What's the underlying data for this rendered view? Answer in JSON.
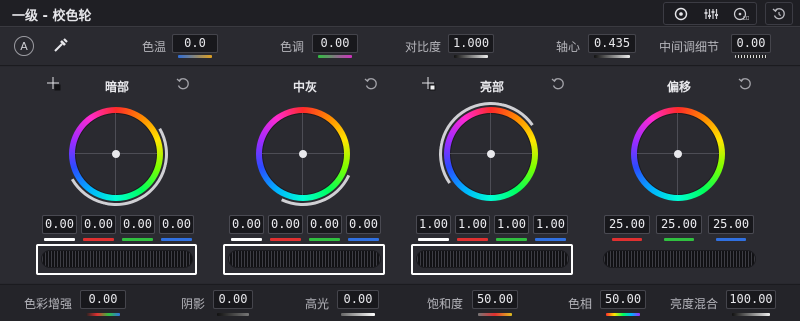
{
  "app": {
    "title": "一级 - 校色轮"
  },
  "toolbar": {
    "icons": [
      "wheels-icon",
      "bars-icon",
      "log-icon",
      "reset-all-icon"
    ],
    "auto_label": "A"
  },
  "params": {
    "temp": {
      "label": "色温",
      "value": "0.0"
    },
    "tint": {
      "label": "色调",
      "value": "0.00"
    },
    "contrast": {
      "label": "对比度",
      "value": "1.000"
    },
    "pivot": {
      "label": "轴心",
      "value": "0.435"
    },
    "middetail": {
      "label": "中间调细节",
      "value": "0.00"
    }
  },
  "wheels": [
    {
      "title": "暗部",
      "values": [
        "0.00",
        "0.00",
        "0.00",
        "0.00"
      ]
    },
    {
      "title": "中灰",
      "values": [
        "0.00",
        "0.00",
        "0.00",
        "0.00"
      ]
    },
    {
      "title": "亮部",
      "values": [
        "1.00",
        "1.00",
        "1.00",
        "1.00"
      ]
    },
    {
      "title": "偏移",
      "values": [
        "25.00",
        "25.00",
        "25.00"
      ]
    }
  ],
  "bottom": {
    "colorboost": {
      "label": "色彩增强",
      "value": "0.00"
    },
    "shadows": {
      "label": "阴影",
      "value": "0.00"
    },
    "highlights": {
      "label": "高光",
      "value": "0.00"
    },
    "saturation": {
      "label": "饱和度",
      "value": "50.00"
    },
    "hue": {
      "label": "色相",
      "value": "50.00"
    },
    "lummix": {
      "label": "亮度混合",
      "value": "100.00"
    }
  },
  "colors": {
    "y": "#ffffff",
    "r": "#e03030",
    "g": "#30c040",
    "b": "#3070e0"
  }
}
